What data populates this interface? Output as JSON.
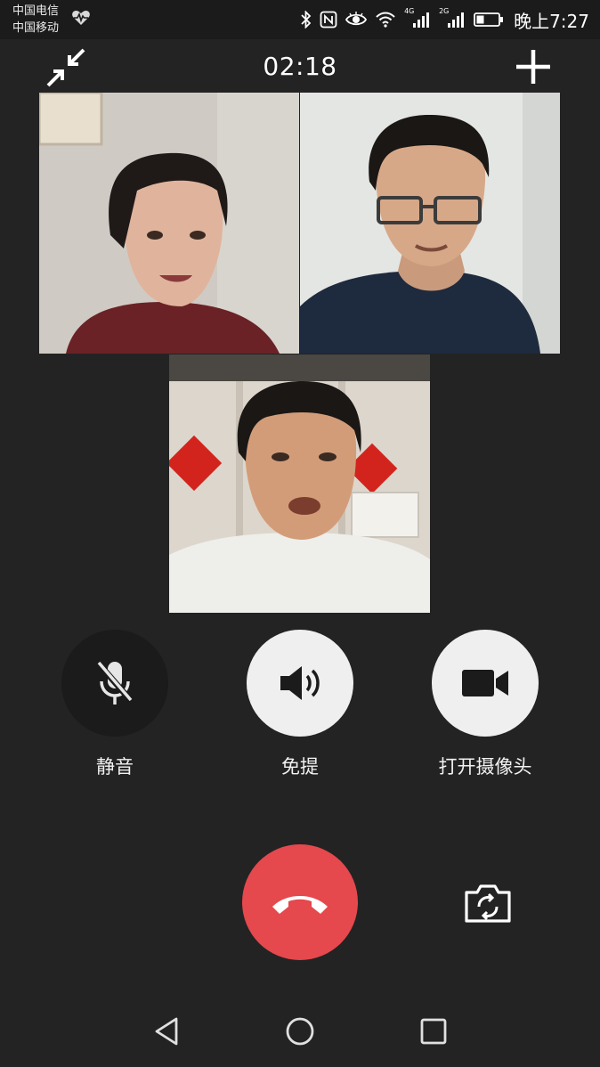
{
  "status_bar": {
    "carrier_1": "中国电信",
    "carrier_2": "中国移动",
    "network_1": "4G",
    "network_2": "2G",
    "time": "晚上7:27",
    "icons": [
      "heart-monitor-icon",
      "bluetooth-icon",
      "nfc-icon",
      "eye-icon",
      "wifi-icon",
      "signal-icon",
      "signal-icon",
      "battery-icon"
    ]
  },
  "call": {
    "timer": "02:18",
    "minimize_icon": "minimize-arrows-icon",
    "add_icon": "plus-icon"
  },
  "participants": [
    {
      "id": "participant-1",
      "tile": "video"
    },
    {
      "id": "participant-2",
      "tile": "video"
    },
    {
      "id": "participant-3",
      "tile": "video"
    }
  ],
  "controls": {
    "mute": {
      "label": "静音",
      "icon": "mic-off-icon",
      "state": "off"
    },
    "speaker": {
      "label": "免提",
      "icon": "speaker-icon",
      "state": "on"
    },
    "camera": {
      "label": "打开摄像头",
      "icon": "video-camera-icon",
      "state": "on"
    }
  },
  "actions": {
    "hangup_icon": "phone-hangup-icon",
    "switch_camera_icon": "camera-switch-icon"
  },
  "nav": {
    "back_icon": "nav-back-icon",
    "home_icon": "nav-home-icon",
    "recent_icon": "nav-recent-icon"
  },
  "colors": {
    "background": "#232323",
    "hangup": "#e5484d",
    "button_light": "#efefef",
    "button_dark": "#1b1b1b"
  }
}
